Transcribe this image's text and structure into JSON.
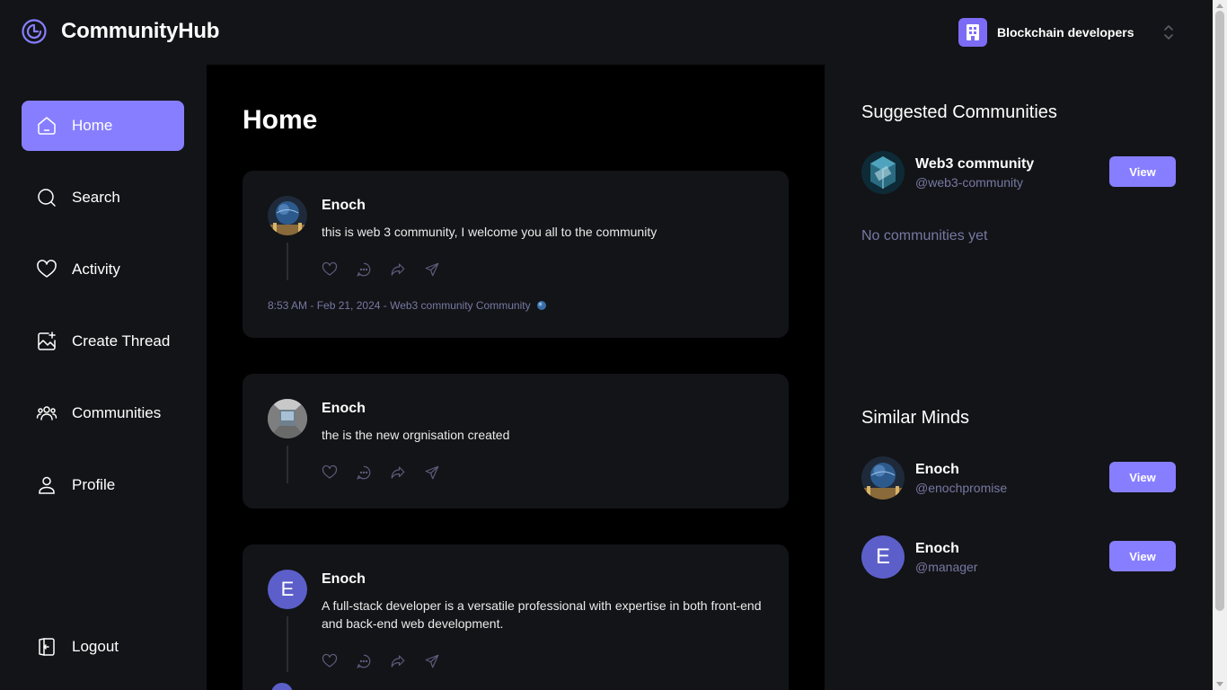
{
  "app": {
    "name": "CommunityHub"
  },
  "org_switcher": {
    "name": "Blockchain developers"
  },
  "sidebar": {
    "items": [
      {
        "label": "Home",
        "icon": "home-icon",
        "active": true
      },
      {
        "label": "Search",
        "icon": "search-icon"
      },
      {
        "label": "Activity",
        "icon": "heart-icon"
      },
      {
        "label": "Create Thread",
        "icon": "create-thread-icon"
      },
      {
        "label": "Communities",
        "icon": "communities-icon"
      },
      {
        "label": "Profile",
        "icon": "profile-icon"
      }
    ],
    "logout_label": "Logout"
  },
  "main": {
    "title": "Home",
    "threads": [
      {
        "author": "Enoch",
        "text": "this is web 3 community, I welcome you all to the community",
        "meta": "8:53 AM - Feb 21, 2024 - Web3 community Community",
        "avatar": "globe-photo"
      },
      {
        "author": "Enoch",
        "text": "the is the new orgnisation created",
        "avatar": "room-photo"
      },
      {
        "author": "Enoch",
        "text": "A full-stack developer is a versatile professional with expertise in both front-end and back-end web development.",
        "avatar": "letter",
        "avatar_letter": "E"
      }
    ]
  },
  "rightbar": {
    "suggested_title": "Suggested Communities",
    "communities": [
      {
        "name": "Web3 community",
        "handle": "@web3-community",
        "button": "View"
      }
    ],
    "empty_text": "No communities yet",
    "similar_title": "Similar Minds",
    "users": [
      {
        "name": "Enoch",
        "handle": "@enochpromise",
        "button": "View",
        "avatar": "globe-photo"
      },
      {
        "name": "Enoch",
        "handle": "@manager",
        "button": "View",
        "avatar": "letter",
        "avatar_letter": "E"
      }
    ]
  },
  "colors": {
    "accent": "#877eff",
    "background": "#121417",
    "main_background": "#000000",
    "muted_text": "#7878a3"
  }
}
